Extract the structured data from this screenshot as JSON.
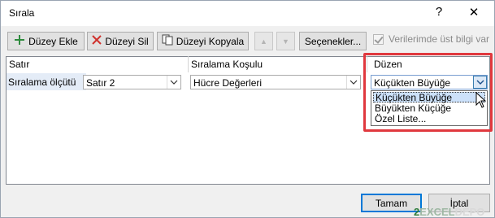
{
  "window": {
    "title": "Sırala",
    "help_glyph": "?",
    "close_glyph": "✕"
  },
  "toolbar": {
    "add_level": "Düzey Ekle",
    "delete_level": "Düzeyi Sil",
    "copy_level": "Düzeyi Kopyala",
    "move_up_glyph": "▲",
    "move_down_glyph": "▼",
    "options": "Seçenekler...",
    "header_checkbox_label": "Verilerimde üst bilgi var",
    "header_checkbox_checked": true
  },
  "columns": {
    "column": "Satır",
    "sort_on": "Sıralama Koşulu",
    "order": "Düzen"
  },
  "row": {
    "label": "Sıralama ölçütü",
    "column_value": "Satır 2",
    "sort_on_value": "Hücre Değerleri",
    "order_value": "Küçükten Büyüğe"
  },
  "order_dropdown": {
    "options": [
      "Küçükten Büyüğe",
      "Büyükten Küçüğe",
      "Özel Liste..."
    ],
    "selected_index": 0
  },
  "footer": {
    "ok": "Tamam",
    "cancel": "İptal"
  },
  "watermark": {
    "part1": "2",
    "part2": "EXCEL",
    "part3": "DEPO"
  },
  "colors": {
    "highlight": "#e0383e",
    "accent": "#0078d7",
    "selection": "#cce1fa"
  }
}
